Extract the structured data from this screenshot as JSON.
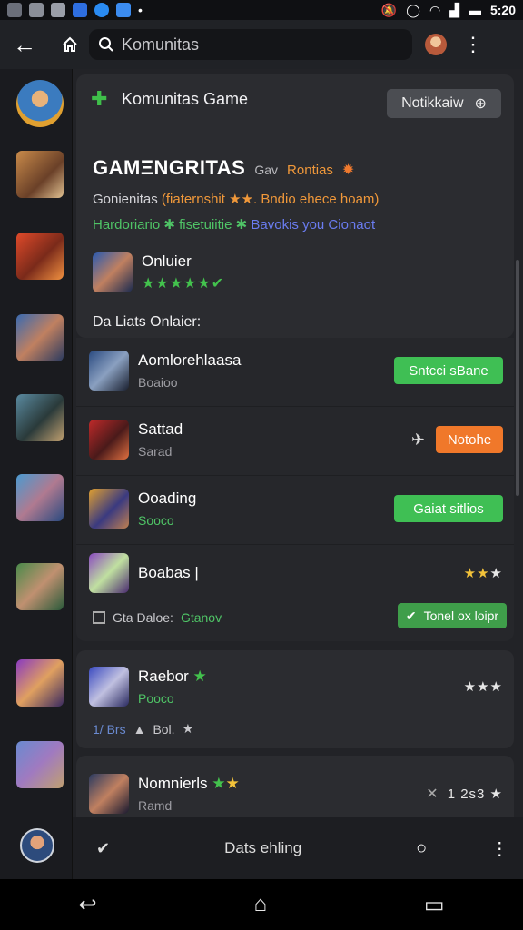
{
  "status_bar": {
    "time": "5:20",
    "icons": [
      "app-icon-1",
      "app-icon-2",
      "app-icon-3",
      "shield-icon",
      "messenger-icon",
      "cloud-icon",
      "mute-icon",
      "alarm-icon",
      "wifi-icon",
      "signal-icon",
      "battery-icon"
    ]
  },
  "app_bar": {
    "search_value": "Komunitas"
  },
  "header_card": {
    "title": "Komunitas Game",
    "notif_button": "Notikkaiw",
    "big_title": "GAMΞNGRITAS",
    "big_title_sub": "Gav",
    "big_title_accent": "Rontias",
    "desc1_a": "Gonienitas",
    "desc1_b": "(fiaternshit ★★. Bndio ehece hoam)",
    "desc2_a": "Hardoriario ✱ fisetuiitie ✱",
    "desc2_b": "Bavokis you Cionaot",
    "online_label": "Onluier",
    "online_stars": "★★★★★✔",
    "data_list_label": "Da Liats Onlaier:"
  },
  "list_rows": [
    {
      "title": "Aomlorehlaasa",
      "sub": "Boaioo",
      "action": "Sntcci sBane"
    },
    {
      "title": "Sattad",
      "sub": "Sarad",
      "action": "Notohe"
    },
    {
      "title": "Ooading",
      "sub": "Sooco",
      "action": "Gaiat sitlios"
    },
    {
      "title": "Boabas |",
      "sub": "",
      "rating": "★★★"
    }
  ],
  "row4_subline": {
    "label": "Gta Daloe:",
    "status": "Gtanov",
    "button": "Tonel ox loipr"
  },
  "card3": {
    "title": "Raebor",
    "sub": "Pooco",
    "rating": "★★★",
    "meta_a": "1/ Brs",
    "meta_b": "Bol."
  },
  "card4": {
    "title": "Nomnierls",
    "sub": "Ramd",
    "rating": "1 2s3 ★"
  },
  "bottom_bar": {
    "label": "Dats ehling"
  },
  "colors": {
    "accent_green": "#3fbf54",
    "accent_orange": "#f0782a",
    "accent_blue": "#6a7cf0",
    "background": "#1c1d21"
  }
}
